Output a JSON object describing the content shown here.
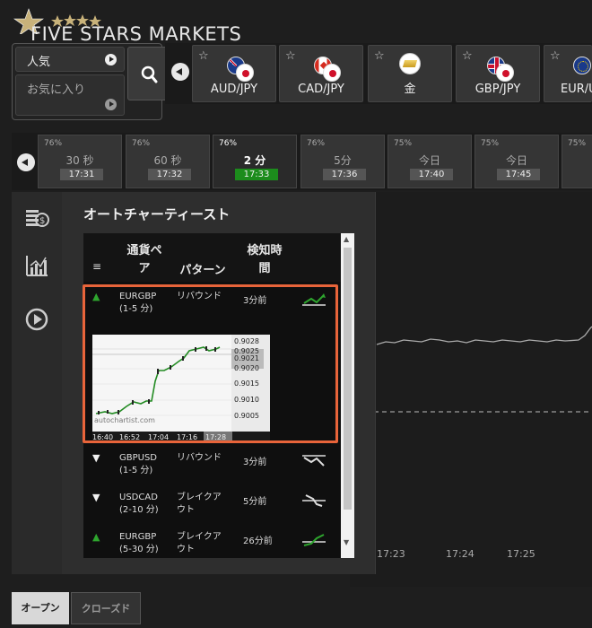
{
  "brand": {
    "name": "FIVE STARS MARKETS"
  },
  "favorites": {
    "popular_label": "人気",
    "favorites_label": "お気に入り"
  },
  "assets": [
    {
      "label": "AUD/JPY",
      "icon": "aud-jpy-flag-icon"
    },
    {
      "label": "CAD/JPY",
      "icon": "cad-jpy-flag-icon"
    },
    {
      "label": "金",
      "icon": "gold-bar-icon"
    },
    {
      "label": "GBP/JPY",
      "icon": "gbp-jpy-flag-icon"
    },
    {
      "label": "EUR/U",
      "icon": "eur-flag-icon"
    }
  ],
  "timeframes": [
    {
      "pct": "76%",
      "label": "30 秒",
      "time": "17:31",
      "active": false
    },
    {
      "pct": "76%",
      "label": "60 秒",
      "time": "17:32",
      "active": false
    },
    {
      "pct": "76%",
      "label": "2 分",
      "time": "17:33",
      "active": true
    },
    {
      "pct": "76%",
      "label": "5分",
      "time": "17:36",
      "active": false
    },
    {
      "pct": "75%",
      "label": "今日",
      "time": "17:40",
      "active": false
    },
    {
      "pct": "75%",
      "label": "今日",
      "time": "17:45",
      "active": false
    },
    {
      "pct": "75%",
      "label": "",
      "time": "",
      "active": false
    }
  ],
  "panel": {
    "title": "オートチャーティースト",
    "headers": {
      "pair": "通貨ペ\nア",
      "pattern": "パターン",
      "time": "検知時\n間"
    }
  },
  "rows": [
    {
      "dir": "up",
      "pair": "EURGBP\n(1-5 分)",
      "pattern": "リバウンド",
      "ago": "3分前"
    },
    {
      "dir": "down",
      "pair": "GBPUSD\n(1-5 分)",
      "pattern": "リバウンド",
      "ago": "3分前"
    },
    {
      "dir": "down",
      "pair": "USDCAD\n(2-10 分)",
      "pattern": "ブレイクア\nウト",
      "ago": "5分前"
    },
    {
      "dir": "up",
      "pair": "EURGBP\n(5-30 分)",
      "pattern": "ブレイクア\nウト",
      "ago": "26分前"
    }
  ],
  "mini_chart": {
    "watermark": "autochartist.com",
    "y_labels": [
      "0.9028",
      "0.9025",
      "0.9021",
      "0.9020",
      "0.9015",
      "0.9010",
      "0.9005"
    ],
    "x_labels": [
      "16:40",
      "16:52",
      "17:04",
      "17:16",
      "17:28"
    ]
  },
  "main_chart": {
    "x_labels": [
      "17:23",
      "17:24",
      "17:25"
    ]
  },
  "bottom_tabs": {
    "open": "オープン",
    "closed": "クローズド"
  },
  "colors": {
    "accent_green": "#1c8c1c",
    "highlight": "#e8643a"
  }
}
